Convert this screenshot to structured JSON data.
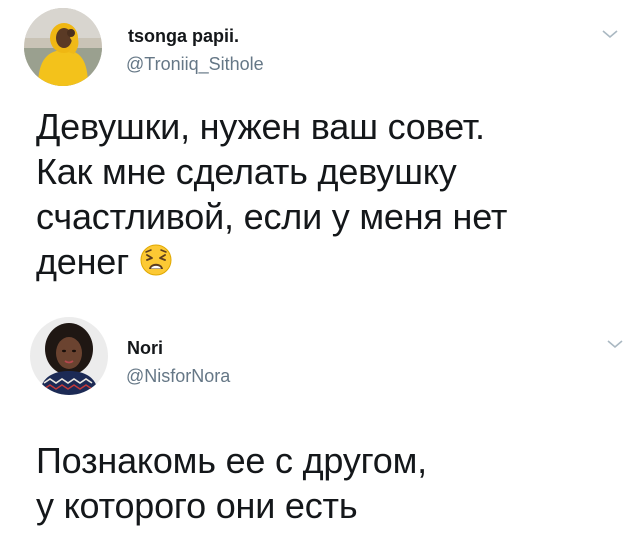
{
  "tweets": [
    {
      "display_name": "tsonga papii.",
      "handle": "@Troniiq_Sithole",
      "text": "Девушки, нужен ваш совет.\nКак мне сделать девушку\nсчастливой, если у меня нет\nденег",
      "emoji": "weary-face-emoji",
      "avatar": "avatar-man-yellow-hoodie"
    },
    {
      "display_name": "Nori",
      "handle": "@NisforNora",
      "text": "Познакомь ее с другом,\nу которого они есть",
      "avatar": "avatar-woman-curly-hair"
    }
  ],
  "colors": {
    "text": "#14171a",
    "secondary": "#657786",
    "caret": "#aab8c2"
  }
}
